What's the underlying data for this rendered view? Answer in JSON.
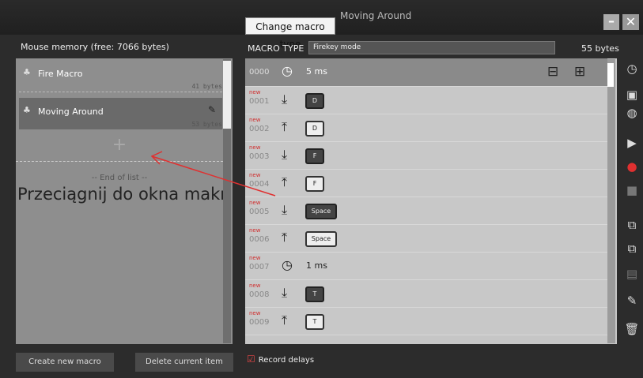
{
  "window": {
    "title": "Moving Around",
    "change_macro_type_label": "Change macro type",
    "minimize_label": "–",
    "close_label": "✕"
  },
  "left_panel": {
    "memory_label": "Mouse memory (free: 7066 bytes)",
    "macros": [
      {
        "name": "Fire Macro",
        "bytes": "41 bytes"
      },
      {
        "name": "Moving Around",
        "bytes": "53 bytes"
      }
    ],
    "add_glyph": "+",
    "end_of_list": "-- End of list --",
    "hint_text": "Przeciągnij do okna makr"
  },
  "bottom": {
    "create_label": "Create new macro",
    "delete_label": "Delete current item",
    "record_delays_label": "Record delays"
  },
  "macro": {
    "type_label": "MACRO TYPE",
    "type_value": "Firekey mode",
    "size": "55 bytes",
    "new_tag": "new",
    "steps": [
      {
        "num": "0000",
        "action": "delay",
        "value": "5 ms",
        "new": false
      },
      {
        "num": "0001",
        "action": "down",
        "value": "D",
        "new": true
      },
      {
        "num": "0002",
        "action": "up",
        "value": "D",
        "new": true
      },
      {
        "num": "0003",
        "action": "down",
        "value": "F",
        "new": true
      },
      {
        "num": "0004",
        "action": "up",
        "value": "F",
        "new": true
      },
      {
        "num": "0005",
        "action": "down",
        "value": "Space",
        "new": true
      },
      {
        "num": "0006",
        "action": "up",
        "value": "Space",
        "new": true
      },
      {
        "num": "0007",
        "action": "delay",
        "value": "1 ms",
        "new": true
      },
      {
        "num": "0008",
        "action": "down",
        "value": "T",
        "new": true
      },
      {
        "num": "0009",
        "action": "up",
        "value": "T",
        "new": true
      }
    ]
  },
  "colors": {
    "accent_red": "#e03030",
    "panel_gray": "#c6c6c6"
  }
}
